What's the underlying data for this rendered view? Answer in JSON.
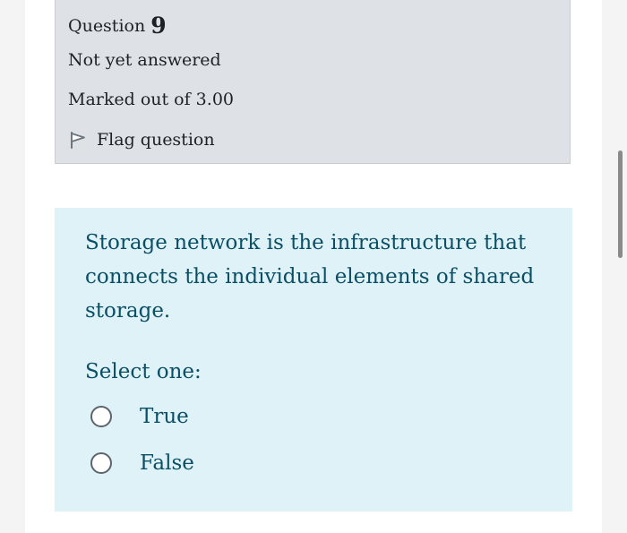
{
  "question_info": {
    "title_prefix": "Question",
    "number": "9",
    "state": "Not yet answered",
    "grade": "Marked out of 3.00",
    "flag_label": "Flag question"
  },
  "question": {
    "text": "Storage network is the infrastructure that connects the individual elements of shared storage.",
    "prompt": "Select one:",
    "options": [
      {
        "label": "True",
        "selected": false
      },
      {
        "label": "False",
        "selected": false
      }
    ]
  },
  "colors": {
    "info_background": "#dee2e6",
    "content_background": "#def2f8",
    "question_text": "#0b4f66",
    "info_text": "#1d2125"
  },
  "icons": {
    "flag": "flag-icon",
    "radio": "radio-unchecked-icon"
  }
}
